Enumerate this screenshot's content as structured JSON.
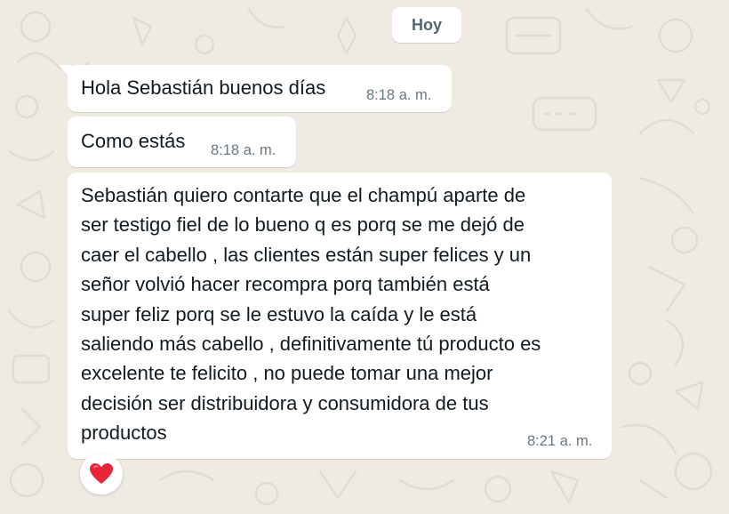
{
  "chat": {
    "date_chip": "Hoy",
    "messages": [
      {
        "text": "Hola Sebastián buenos días",
        "time": "8:18 a. m."
      },
      {
        "text": "Como estás",
        "time": "8:18 a. m."
      },
      {
        "lines": [
          "Sebastián quiero contarte que el champú aparte de",
          "ser testigo fiel de lo bueno q es porq se me dejó de",
          "caer el cabello , las clientes están super felices y un",
          "señor volvió hacer recompra porq también está",
          "super feliz porq se le estuvo la caída y le está",
          "saliendo más cabello , definitivamente tú producto es",
          "excelente te felicito , no puede tomar una mejor",
          "decisión ser distribuidora y consumidora de tus",
          "productos"
        ],
        "time": "8:21 a. m.",
        "reaction": "red-heart"
      }
    ]
  },
  "colors": {
    "wallpaper": "#efeae2",
    "bubble": "#ffffff",
    "text": "#111b21",
    "timestamp": "#667781",
    "reaction_heart": "#e8253b"
  }
}
